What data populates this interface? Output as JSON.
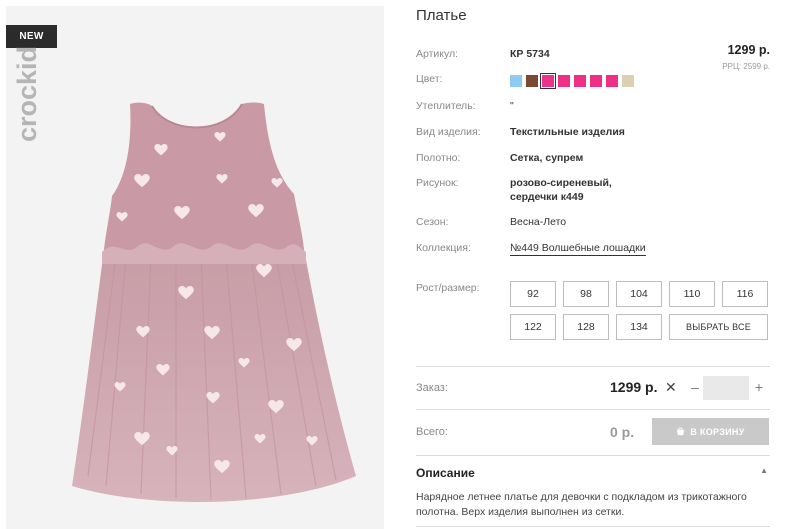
{
  "badge": "NEW",
  "brand": "crockid",
  "product": {
    "title": "Платье",
    "price": "1299 р.",
    "rrp": "РРЦ: 2599 р."
  },
  "attributes": [
    {
      "label": "Артикул:",
      "value": "КР 5734"
    },
    {
      "label": "Цвет:",
      "value": ""
    },
    {
      "label": "Утеплитель:",
      "value": "\""
    },
    {
      "label": "Вид изделия:",
      "value": "Текстильные изделия"
    },
    {
      "label": "Полотно:",
      "value": "Сетка, супрем"
    },
    {
      "label": "Рисунок:",
      "value": "розово-сиреневый,"
    },
    {
      "label": "",
      "value": "сердечки к449"
    },
    {
      "label": "Сезон:",
      "value": "Весна-Лето"
    },
    {
      "label": "Коллекция:",
      "value": "№449 Волшебные лошадки"
    }
  ],
  "colors": [
    {
      "hex": "#8ecbf0",
      "selected": false
    },
    {
      "hex": "#7a4a33",
      "selected": false
    },
    {
      "hex": "#e8358a",
      "selected": true
    },
    {
      "hex": "#ee2f86",
      "selected": false
    },
    {
      "hex": "#ee2f86",
      "selected": false
    },
    {
      "hex": "#ee2f86",
      "selected": false
    },
    {
      "hex": "#ee2f86",
      "selected": false
    },
    {
      "hex": "#dccfb2",
      "selected": false
    }
  ],
  "sizes": {
    "label": "Рост/размер:",
    "options": [
      "92",
      "98",
      "104",
      "110",
      "116",
      "122",
      "128",
      "134"
    ],
    "select_all": "ВЫБРАТЬ ВСЕ"
  },
  "order": {
    "label": "Заказ:",
    "price": "1299 р.",
    "times": "✕",
    "minus": "–",
    "plus": "+",
    "quantity": ""
  },
  "total": {
    "label": "Всего:",
    "value": "0 р.",
    "cart_button": "В КОРЗИНУ"
  },
  "description": {
    "title": "Описание",
    "toggle": "▲",
    "text": "Нарядное летнее платье для девочки с подкладом из трикотажного полотна. Верх изделия выполнен из сетки."
  },
  "icons": {
    "cart": "cart-icon",
    "logo": "crockid-logo"
  }
}
